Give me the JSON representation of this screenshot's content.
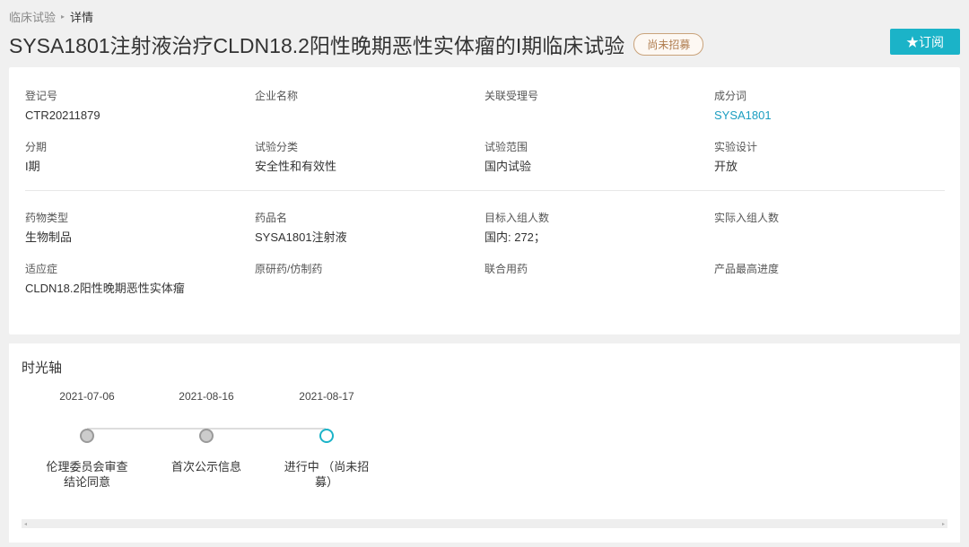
{
  "breadcrumb": {
    "parent": "临床试验",
    "separator": "▸",
    "current": "详情"
  },
  "title": "SYSA1801注射液治疗CLDN18.2阳性晚期恶性实体瘤的I期临床试验",
  "status_badge": "尚未招募",
  "subscribe_button": "★订阅",
  "details_section1": [
    {
      "label": "登记号",
      "value": "CTR20211879"
    },
    {
      "label": "企业名称",
      "value": ""
    },
    {
      "label": "关联受理号",
      "value": ""
    },
    {
      "label": "成分词",
      "value": "SYSA1801",
      "link": true
    },
    {
      "label": "分期",
      "value": "I期"
    },
    {
      "label": "试验分类",
      "value": "安全性和有效性"
    },
    {
      "label": "试验范围",
      "value": "国内试验"
    },
    {
      "label": "实验设计",
      "value": "开放"
    }
  ],
  "details_section2": [
    {
      "label": "药物类型",
      "value": "生物制品"
    },
    {
      "label": "药品名",
      "value": "SYSA1801注射液"
    },
    {
      "label": "目标入组人数",
      "value": "国内: 272；"
    },
    {
      "label": "实际入组人数",
      "value": ""
    },
    {
      "label": "适应症",
      "value": "CLDN18.2阳性晚期恶性实体瘤"
    },
    {
      "label": "原研药/仿制药",
      "value": ""
    },
    {
      "label": "联合用药",
      "value": ""
    },
    {
      "label": "产品最高进度",
      "value": ""
    }
  ],
  "timeline": {
    "title": "时光轴",
    "items": [
      {
        "date": "2021-07-06",
        "text": "伦理委员会审查结论同意",
        "active": false
      },
      {
        "date": "2021-08-16",
        "text": "首次公示信息",
        "active": false
      },
      {
        "date": "2021-08-17",
        "text": "进行中 （尚未招募）",
        "active": true
      }
    ]
  },
  "colors": {
    "accent": "#1bb3c8",
    "link": "#1b9dc0",
    "badge_border": "#c9a27a"
  }
}
